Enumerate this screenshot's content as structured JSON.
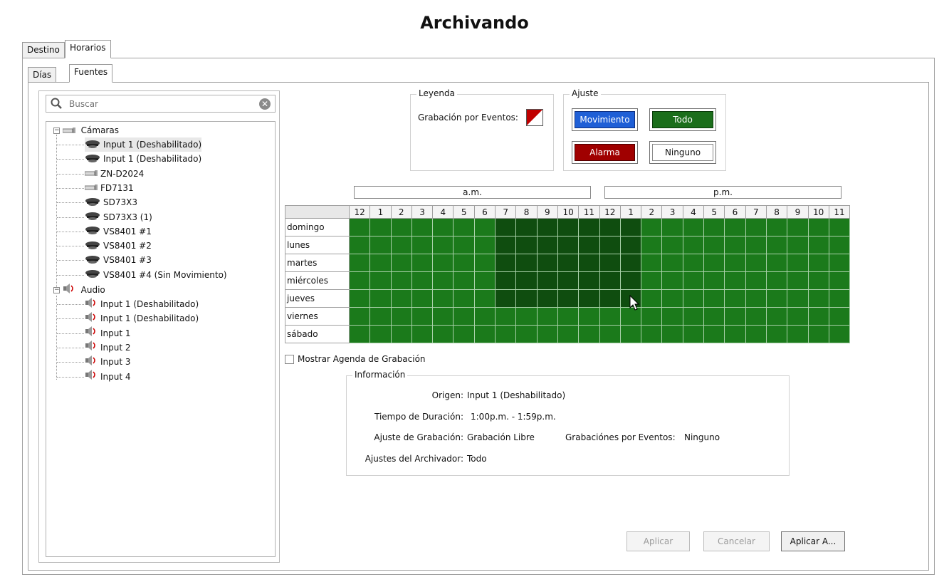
{
  "window": {
    "title": "Archivando"
  },
  "tabs_top": [
    {
      "label": "Destino"
    },
    {
      "label": "Horarios",
      "active": true
    }
  ],
  "tabs_sub": [
    {
      "label": "Días"
    },
    {
      "label": "Fuentes",
      "active": true
    }
  ],
  "search": {
    "placeholder": "Buscar"
  },
  "tree": {
    "cameras_label": "Cámaras",
    "cameras": [
      "Input 1 (Deshabilitado)",
      "Input 1 (Deshabilitado)",
      "ZN-D2024",
      "FD7131",
      "SD73X3",
      "SD73X3 (1)",
      "VS8401 #1",
      "VS8401 #2",
      "VS8401 #3",
      "VS8401 #4 (Sin Movimiento)"
    ],
    "audio_label": "Audio",
    "audio": [
      "Input 1 (Deshabilitado)",
      "Input 1 (Deshabilitado)",
      "Input 1",
      "Input 2",
      "Input 3",
      "Input 4"
    ]
  },
  "legend": {
    "title": "Leyenda",
    "event_recording_label": "Grabación por Eventos:"
  },
  "ajuste": {
    "title": "Ajuste",
    "movimiento": "Movimiento",
    "todo": "Todo",
    "alarma": "Alarma",
    "ninguno": "Ninguno",
    "colors": {
      "movimiento": "#1f5fd6",
      "todo": "#1b6e1b",
      "alarma": "#a00000",
      "grid": "#1b7a1b",
      "grid_selected": "#0f4d0f"
    }
  },
  "schedule": {
    "am_label": "a.m.",
    "pm_label": "p.m.",
    "hours": [
      "12",
      "1",
      "2",
      "3",
      "4",
      "5",
      "6",
      "7",
      "8",
      "9",
      "10",
      "11",
      "12",
      "1",
      "2",
      "3",
      "4",
      "5",
      "6",
      "7",
      "8",
      "9",
      "10",
      "11"
    ],
    "days": [
      "domingo",
      "lunes",
      "martes",
      "miércoles",
      "jueves",
      "viernes",
      "sábado"
    ],
    "selected_hours_start": 7,
    "selected_hours_end": 13
  },
  "show_schedule": {
    "label": "Mostrar Agenda de Grabación",
    "checked": false
  },
  "info": {
    "title": "Información",
    "origen_label": "Origen:",
    "origen_value": "Input 1 (Deshabilitado)",
    "duracion_label": "Tiempo de Duración:",
    "duracion_value": "1:00p.m. - 1:59p.m.",
    "ajuste_label": "Ajuste de Grabación:",
    "ajuste_value": "Grabación Libre",
    "eventos_label": "Grabaciónes por Eventos:",
    "eventos_value": "Ninguno",
    "archivador_label": "Ajustes del Archivador:",
    "archivador_value": "Todo"
  },
  "buttons": {
    "aplicar": "Aplicar",
    "cancelar": "Cancelar",
    "aplicar_a": "Aplicar A..."
  }
}
